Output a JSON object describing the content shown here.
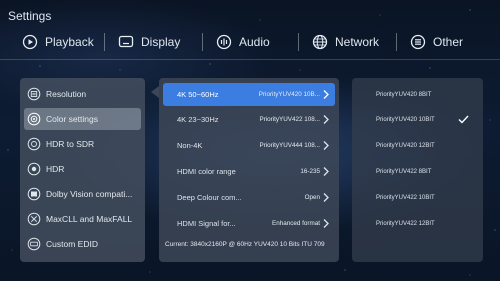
{
  "header": {
    "title": "Settings"
  },
  "topnav": {
    "tabs": [
      {
        "label": "Playback",
        "icon": "play-circle-icon"
      },
      {
        "label": "Display",
        "icon": "display-icon"
      },
      {
        "label": "Audio",
        "icon": "audio-icon"
      },
      {
        "label": "Network",
        "icon": "globe-icon"
      },
      {
        "label": "Other",
        "icon": "menu-icon"
      }
    ]
  },
  "sidebar": {
    "items": [
      {
        "label": "Resolution",
        "icon": "resolution-icon"
      },
      {
        "label": "Color settings",
        "icon": "color-settings-icon",
        "active": true
      },
      {
        "label": "HDR to SDR",
        "icon": "hdr-to-sdr-icon"
      },
      {
        "label": "HDR",
        "icon": "hdr-icon"
      },
      {
        "label": "Dolby Vision compati...",
        "icon": "dolby-vision-icon"
      },
      {
        "label": "MaxCLL and MaxFALL",
        "icon": "maxcll-icon"
      },
      {
        "label": "Custom EDID",
        "icon": "edid-icon"
      }
    ]
  },
  "settings": {
    "rows": [
      {
        "label": "4K 50~60Hz",
        "value": "PriorityYUV420 10B...",
        "active": true
      },
      {
        "label": "4K 23~30Hz",
        "value": "PriorityYUV422 108..."
      },
      {
        "label": "Non-4K",
        "value": "PriorityYUV444 108..."
      },
      {
        "label": "HDMI color range",
        "value": "16-235"
      },
      {
        "label": "Deep Colour com...",
        "value": "Open"
      },
      {
        "label": "HDMI Signal for...",
        "value": "Enhanced format"
      }
    ],
    "current": "Current: 3840x2160P @ 60Hz  YUV420  10 Bits  ITU 709"
  },
  "options": {
    "items": [
      {
        "label": "PriorityYUV420 8BIT"
      },
      {
        "label": "PriorityYUV420 10BIT",
        "selected": true
      },
      {
        "label": "PriorityYUV420 12BIT"
      },
      {
        "label": "PriorityYUV422 8BIT"
      },
      {
        "label": "PriorityYUV422 10BIT"
      },
      {
        "label": "PriorityYUV422 12BIT"
      }
    ]
  },
  "colors": {
    "accent": "#3b7de0",
    "background": "#0d1c33"
  }
}
